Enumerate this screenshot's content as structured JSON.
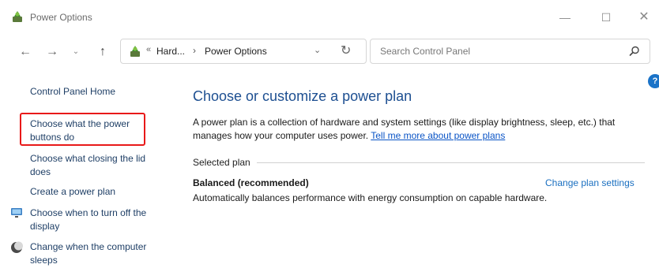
{
  "window": {
    "title": "Power Options",
    "minimize_glyph": "—",
    "maximize_glyph": "☐",
    "close_glyph": "✕"
  },
  "nav": {
    "back_glyph": "←",
    "forward_glyph": "→",
    "recent_glyph": "⌄",
    "up_glyph": "↑"
  },
  "address": {
    "separator": "«",
    "crumb_1": "Hard...",
    "chevron": "›",
    "crumb_2": "Power Options",
    "dropdown_glyph": "⌄",
    "refresh_glyph": "↻"
  },
  "search": {
    "placeholder": "Search Control Panel"
  },
  "help": {
    "glyph": "?"
  },
  "sidebar": {
    "home": "Control Panel Home",
    "items": [
      {
        "label": "Choose what the power buttons do"
      },
      {
        "label": "Choose what closing the lid does"
      },
      {
        "label": "Create a power plan"
      },
      {
        "label": "Choose when to turn off the display"
      },
      {
        "label": "Change when the computer sleeps"
      }
    ]
  },
  "main": {
    "title": "Choose or customize a power plan",
    "description": "A power plan is a collection of hardware and system settings (like display brightness, sleep, etc.) that manages how your computer uses power. ",
    "learn_more_link": "Tell me more about power plans",
    "section_label": "Selected plan",
    "plan_name": "Balanced (recommended)",
    "change_plan_link": "Change plan settings",
    "plan_description": "Automatically balances performance with energy consumption on capable hardware."
  },
  "colors": {
    "highlight": "#e81919",
    "link": "#1a6fc0",
    "title": "#1d4f91"
  }
}
